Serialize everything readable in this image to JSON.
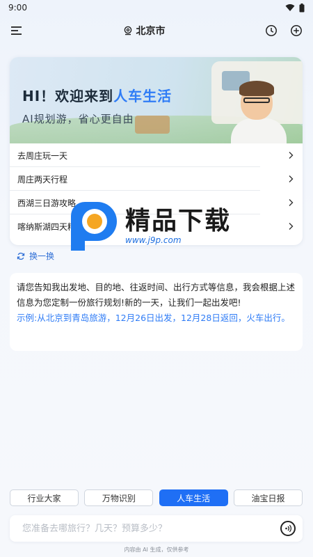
{
  "status_bar": {
    "time": "9:00"
  },
  "header": {
    "location": "北京市",
    "icons": [
      "menu-icon",
      "location-pin-icon",
      "history-icon",
      "add-icon"
    ]
  },
  "banner": {
    "title_prefix": "HI！欢迎来到",
    "title_accent": "人车生活",
    "subtitle": "AI规划游，省心更自由"
  },
  "suggestions": [
    {
      "label": "去周庄玩一天"
    },
    {
      "label": "周庄两天行程"
    },
    {
      "label": "西湖三日游攻略"
    },
    {
      "label": "喀纳斯湖四天精华游攻略"
    }
  ],
  "refresh_label": "换一换",
  "intro": {
    "text": "请您告知我出发地、目的地、往返时间、出行方式等信息，我会根据上述信息为您定制一份旅行规划!新的一天，让我们一起出发吧!",
    "example": "示例:从北京到青岛旅游，12月26日出发，12月28日返回，火车出行。"
  },
  "watermark": {
    "title": "精品下载",
    "url": "www.j9p.com"
  },
  "chips": [
    {
      "label": "行业大家",
      "active": false
    },
    {
      "label": "万物识别",
      "active": false
    },
    {
      "label": "人车生活",
      "active": true
    },
    {
      "label": "油宝日报",
      "active": false
    }
  ],
  "input": {
    "placeholder": "您准备去哪旅行？几天？预算多少？"
  },
  "footer_note": "内容由 AI 生成，仅供参考",
  "colors": {
    "accent": "#1f6ff5",
    "example_text": "#2f7cf6"
  }
}
